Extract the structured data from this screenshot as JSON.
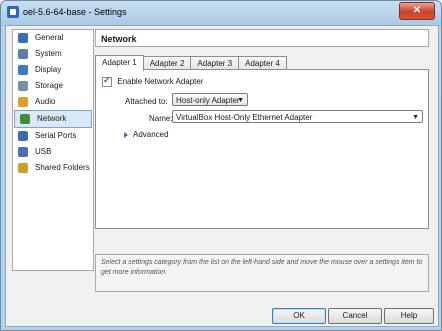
{
  "window": {
    "title": "oel-5.6-64-base - Settings",
    "close_label": "✕"
  },
  "sidebar": {
    "items": [
      {
        "label": "General",
        "icon": "general-icon",
        "color": "#3a6fb5"
      },
      {
        "label": "System",
        "icon": "system-icon",
        "color": "#5a7fa0"
      },
      {
        "label": "Display",
        "icon": "display-icon",
        "color": "#3c78c3"
      },
      {
        "label": "Storage",
        "icon": "storage-icon",
        "color": "#7a8fa2"
      },
      {
        "label": "Audio",
        "icon": "audio-icon",
        "color": "#d7a12a"
      },
      {
        "label": "Network",
        "icon": "network-icon",
        "color": "#3d8f3c"
      },
      {
        "label": "Serial Ports",
        "icon": "serial-ports-icon",
        "color": "#3e6ca8"
      },
      {
        "label": "USB",
        "icon": "usb-icon",
        "color": "#4b6fb0"
      },
      {
        "label": "Shared Folders",
        "icon": "shared-folders-icon",
        "color": "#c9a227"
      }
    ],
    "selected": "Network"
  },
  "page": {
    "title": "Network"
  },
  "tabs": [
    "Adapter 1",
    "Adapter 2",
    "Adapter 3",
    "Adapter 4"
  ],
  "adapter": {
    "enable_label": "Enable Network Adapter",
    "attached_label": "Attached to:",
    "attached_value": "Host-only Adapter",
    "name_label": "Name:",
    "name_value": "VirtualBox Host-Only Ethernet Adapter",
    "advanced_label": "Advanced"
  },
  "info": {
    "text": "Select a settings category from the list on the left-hand side and move the mouse over a settings item to get more information."
  },
  "buttons": {
    "ok": "OK",
    "cancel": "Cancel",
    "help": "Help"
  }
}
